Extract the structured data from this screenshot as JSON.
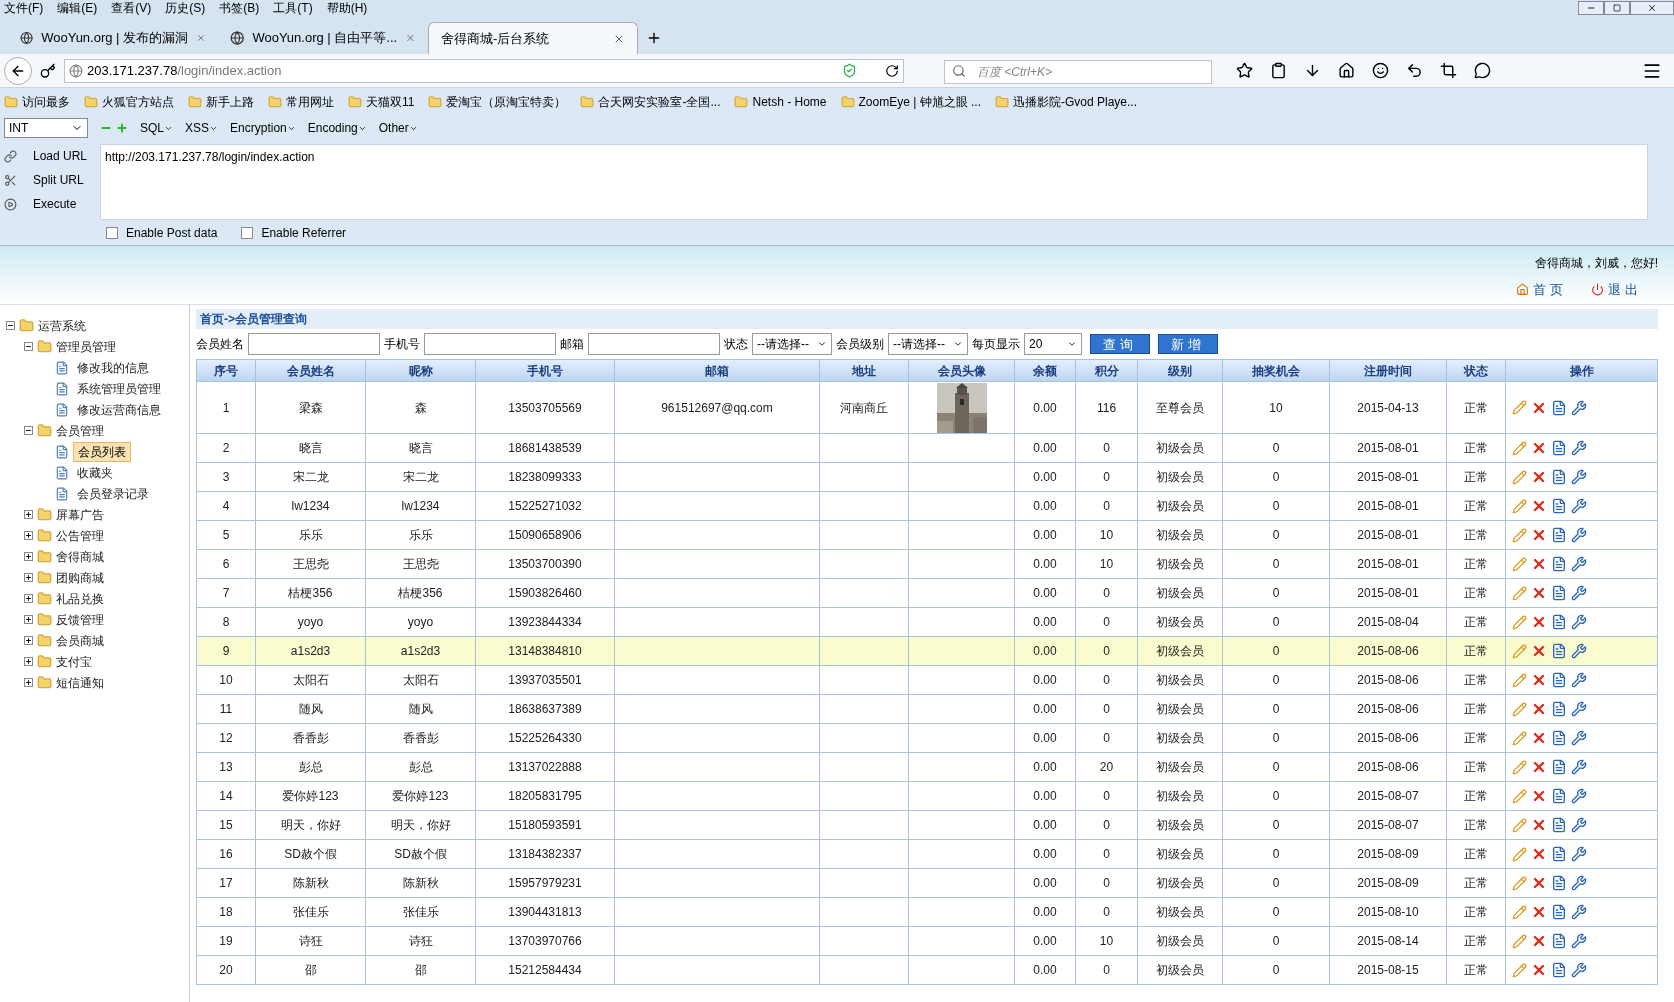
{
  "menu_bar": [
    "文件(F)",
    "编辑(E)",
    "查看(V)",
    "历史(S)",
    "书签(B)",
    "工具(T)",
    "帮助(H)"
  ],
  "tabs": [
    {
      "label": "WooYun.org | 发布的漏洞",
      "selected": false
    },
    {
      "label": "WooYun.org | 自由平等...",
      "selected": false
    },
    {
      "label": "舍得商城-后台系统",
      "selected": true
    }
  ],
  "address_bar": {
    "host": "203.171.237.78",
    "path": "/login/index.action"
  },
  "search": {
    "placeholder": "百度 <Ctrl+K>"
  },
  "bookmarks": [
    "访问最多",
    "火狐官方站点",
    "新手上路",
    "常用网址",
    "天猫双11",
    "爱淘宝（原淘宝特卖）",
    "合天网安实验室-全国...",
    "Netsh - Home",
    "ZoomEye | 钟馗之眼 ...",
    "迅播影院-Gvod Playe..."
  ],
  "hackbar": {
    "type_select": "INT",
    "menus": [
      "SQL",
      "XSS",
      "Encryption",
      "Encoding",
      "Other"
    ],
    "actions": [
      "Load URL",
      "Split URL",
      "Execute"
    ],
    "url_value": "http://203.171.237.78/login/index.action",
    "options": [
      {
        "label": "Enable Post data",
        "checked": false
      },
      {
        "label": "Enable Referrer",
        "checked": false
      }
    ]
  },
  "header": {
    "greeting": "舍得商城，刘威，您好!",
    "links": [
      "首页",
      "退出"
    ]
  },
  "sidebar": [
    {
      "label": "运营系统",
      "kind": "folder",
      "expanded": true,
      "children": [
        {
          "label": "管理员管理",
          "kind": "folder",
          "expanded": true,
          "children": [
            {
              "label": "修改我的信息",
              "kind": "leaf",
              "selected": false
            },
            {
              "label": "系统管理员管理",
              "kind": "leaf",
              "selected": false
            },
            {
              "label": "修改运营商信息",
              "kind": "leaf",
              "selected": false
            }
          ]
        },
        {
          "label": "会员管理",
          "kind": "folder",
          "expanded": true,
          "children": [
            {
              "label": "会员列表",
              "kind": "leaf",
              "selected": true
            },
            {
              "label": "收藏夹",
              "kind": "leaf",
              "selected": false
            },
            {
              "label": "会员登录记录",
              "kind": "leaf",
              "selected": false
            }
          ]
        },
        {
          "label": "屏幕广告",
          "kind": "folder",
          "expanded": false
        },
        {
          "label": "公告管理",
          "kind": "folder",
          "expanded": false
        },
        {
          "label": "舍得商城",
          "kind": "folder",
          "expanded": false
        },
        {
          "label": "团购商城",
          "kind": "folder",
          "expanded": false
        },
        {
          "label": "礼品兑换",
          "kind": "folder",
          "expanded": false
        },
        {
          "label": "反馈管理",
          "kind": "folder",
          "expanded": false
        },
        {
          "label": "会员商城",
          "kind": "folder",
          "expanded": false
        },
        {
          "label": "支付宝",
          "kind": "folder",
          "expanded": false
        },
        {
          "label": "短信通知",
          "kind": "folder",
          "expanded": false
        }
      ]
    }
  ],
  "breadcrumb": "首页->会员管理查询",
  "filters": {
    "fields": [
      {
        "label": "会员姓名",
        "kind": "input"
      },
      {
        "label": "手机号",
        "kind": "input"
      },
      {
        "label": "邮箱",
        "kind": "input"
      },
      {
        "label": "状态",
        "kind": "select",
        "value": "--请选择--"
      },
      {
        "label": "会员级别",
        "kind": "select",
        "value": "--请选择--"
      },
      {
        "label": "每页显示",
        "kind": "select",
        "value": "20"
      }
    ],
    "buttons": [
      "查询",
      "新增"
    ]
  },
  "table": {
    "columns": [
      "序号",
      "会员姓名",
      "昵称",
      "手机号",
      "邮箱",
      "地址",
      "会员头像",
      "余额",
      "积分",
      "级别",
      "抽奖机会",
      "注册时间",
      "状态",
      "操作"
    ],
    "rows": [
      {
        "cells": [
          "1",
          "梁森",
          "森",
          "13503705569",
          "961512697@qq.com",
          "河南商丘"
        ],
        "avatar": {
          "kind": "picture"
        },
        "rest": [
          "0.00",
          "116",
          "至尊会员",
          "10",
          "2015-04-13",
          "正常"
        ],
        "selected": false
      },
      {
        "cells": [
          "2",
          "晓言",
          "晓言",
          "18681438539",
          "",
          ""
        ],
        "rest": [
          "0.00",
          "0",
          "初级会员",
          "0",
          "2015-08-01",
          "正常"
        ],
        "selected": false
      },
      {
        "cells": [
          "3",
          "宋二龙",
          "宋二龙",
          "18238099333",
          "",
          ""
        ],
        "rest": [
          "0.00",
          "0",
          "初级会员",
          "0",
          "2015-08-01",
          "正常"
        ],
        "selected": false
      },
      {
        "cells": [
          "4",
          "lw1234",
          "lw1234",
          "15225271032",
          "",
          ""
        ],
        "rest": [
          "0.00",
          "0",
          "初级会员",
          "0",
          "2015-08-01",
          "正常"
        ],
        "selected": false
      },
      {
        "cells": [
          "5",
          "乐乐",
          "乐乐",
          "15090658906",
          "",
          ""
        ],
        "rest": [
          "0.00",
          "10",
          "初级会员",
          "0",
          "2015-08-01",
          "正常"
        ],
        "selected": false
      },
      {
        "cells": [
          "6",
          "王思尧",
          "王思尧",
          "13503700390",
          "",
          ""
        ],
        "rest": [
          "0.00",
          "10",
          "初级会员",
          "0",
          "2015-08-01",
          "正常"
        ],
        "selected": false
      },
      {
        "cells": [
          "7",
          "桔梗356",
          "桔梗356",
          "15903826460",
          "",
          ""
        ],
        "rest": [
          "0.00",
          "0",
          "初级会员",
          "0",
          "2015-08-01",
          "正常"
        ],
        "selected": false
      },
      {
        "cells": [
          "8",
          "yoyo",
          "yoyo",
          "13923844334",
          "",
          ""
        ],
        "rest": [
          "0.00",
          "0",
          "初级会员",
          "0",
          "2015-08-04",
          "正常"
        ],
        "selected": false
      },
      {
        "cells": [
          "9",
          "a1s2d3",
          "a1s2d3",
          "13148384810",
          "",
          ""
        ],
        "rest": [
          "0.00",
          "0",
          "初级会员",
          "0",
          "2015-08-06",
          "正常"
        ],
        "selected": true
      },
      {
        "cells": [
          "10",
          "太阳石",
          "太阳石",
          "13937035501",
          "",
          ""
        ],
        "rest": [
          "0.00",
          "0",
          "初级会员",
          "0",
          "2015-08-06",
          "正常"
        ],
        "selected": false
      },
      {
        "cells": [
          "11",
          "随风",
          "随风",
          "18638637389",
          "",
          ""
        ],
        "rest": [
          "0.00",
          "0",
          "初级会员",
          "0",
          "2015-08-06",
          "正常"
        ],
        "selected": false
      },
      {
        "cells": [
          "12",
          "香香彭",
          "香香彭",
          "15225264330",
          "",
          ""
        ],
        "rest": [
          "0.00",
          "0",
          "初级会员",
          "0",
          "2015-08-06",
          "正常"
        ],
        "selected": false
      },
      {
        "cells": [
          "13",
          "彭总",
          "彭总",
          "13137022888",
          "",
          ""
        ],
        "rest": [
          "0.00",
          "20",
          "初级会员",
          "0",
          "2015-08-06",
          "正常"
        ],
        "selected": false
      },
      {
        "cells": [
          "14",
          "爱你婷123",
          "爱你婷123",
          "18205831795",
          "",
          ""
        ],
        "rest": [
          "0.00",
          "0",
          "初级会员",
          "0",
          "2015-08-07",
          "正常"
        ],
        "selected": false
      },
      {
        "cells": [
          "15",
          "明天，你好",
          "明天，你好",
          "15180593591",
          "",
          ""
        ],
        "rest": [
          "0.00",
          "0",
          "初级会员",
          "0",
          "2015-08-07",
          "正常"
        ],
        "selected": false
      },
      {
        "cells": [
          "16",
          "SD赦个假",
          "SD赦个假",
          "13184382337",
          "",
          ""
        ],
        "rest": [
          "0.00",
          "0",
          "初级会员",
          "0",
          "2015-08-09",
          "正常"
        ],
        "selected": false
      },
      {
        "cells": [
          "17",
          "陈新秋",
          "陈新秋",
          "15957979231",
          "",
          ""
        ],
        "rest": [
          "0.00",
          "0",
          "初级会员",
          "0",
          "2015-08-09",
          "正常"
        ],
        "selected": false
      },
      {
        "cells": [
          "18",
          "张佳乐",
          "张佳乐",
          "13904431813",
          "",
          ""
        ],
        "rest": [
          "0.00",
          "0",
          "初级会员",
          "0",
          "2015-08-10",
          "正常"
        ],
        "selected": false
      },
      {
        "cells": [
          "19",
          "诗狂",
          "诗狂",
          "13703970766",
          "",
          ""
        ],
        "rest": [
          "0.00",
          "10",
          "初级会员",
          "0",
          "2015-08-14",
          "正常"
        ],
        "selected": false
      },
      {
        "cells": [
          "20",
          "邵",
          "邵",
          "15212584434",
          "",
          ""
        ],
        "rest": [
          "0.00",
          "0",
          "初级会员",
          "0",
          "2015-08-15",
          "正常"
        ],
        "selected": false
      }
    ]
  }
}
